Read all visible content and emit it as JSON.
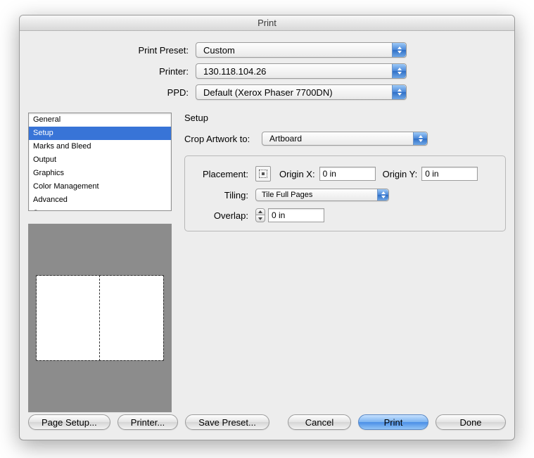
{
  "window": {
    "title": "Print"
  },
  "top": {
    "preset_label": "Print Preset:",
    "preset_value": "Custom",
    "printer_label": "Printer:",
    "printer_value": "130.118.104.26",
    "ppd_label": "PPD:",
    "ppd_value": "Default (Xerox Phaser 7700DN)"
  },
  "sidebar": {
    "items": [
      "General",
      "Setup",
      "Marks and Bleed",
      "Output",
      "Graphics",
      "Color Management",
      "Advanced",
      "Summary"
    ],
    "selected_index": 1
  },
  "panel": {
    "title": "Setup",
    "crop_label": "Crop Artwork to:",
    "crop_value": "Artboard",
    "placement_label": "Placement:",
    "originx_label": "Origin X:",
    "originx_value": "0 in",
    "originy_label": "Origin Y:",
    "originy_value": "0 in",
    "tiling_label": "Tiling:",
    "tiling_value": "Tile Full Pages",
    "overlap_label": "Overlap:",
    "overlap_value": "0 in"
  },
  "buttons": {
    "page_setup": "Page Setup...",
    "printer": "Printer...",
    "save_preset": "Save Preset...",
    "cancel": "Cancel",
    "print": "Print",
    "done": "Done"
  }
}
